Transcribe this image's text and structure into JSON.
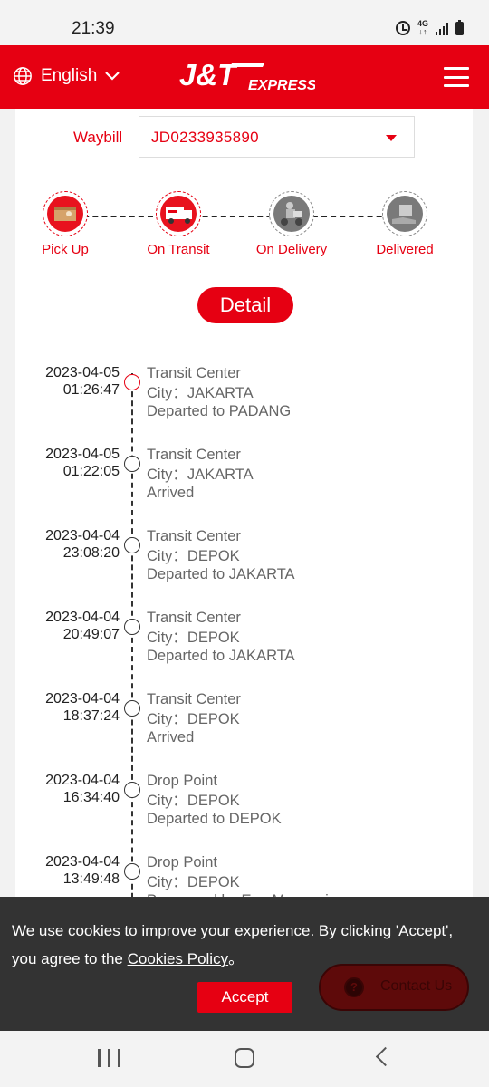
{
  "status_bar": {
    "time": "21:39",
    "network": "4G"
  },
  "header": {
    "language": "English"
  },
  "waybill": {
    "label": "Waybill",
    "value": "JD0233935890"
  },
  "steps": [
    {
      "label": "Pick Up",
      "state": "active"
    },
    {
      "label": "On Transit",
      "state": "active"
    },
    {
      "label": "On Delivery",
      "state": "inactive"
    },
    {
      "label": "Delivered",
      "state": "inactive"
    }
  ],
  "detail_button": "Detail",
  "timeline": [
    {
      "date": "2023-04-05",
      "time": "01:26:47",
      "type": "Transit Center",
      "city": "City：JAKARTA",
      "status": "Departed to PADANG"
    },
    {
      "date": "2023-04-05",
      "time": "01:22:05",
      "type": "Transit Center",
      "city": "City：JAKARTA",
      "status": "Arrived"
    },
    {
      "date": "2023-04-04",
      "time": "23:08:20",
      "type": "Transit Center",
      "city": "City：DEPOK",
      "status": "Departed to JAKARTA"
    },
    {
      "date": "2023-04-04",
      "time": "20:49:07",
      "type": "Transit Center",
      "city": "City：DEPOK",
      "status": "Departed to JAKARTA"
    },
    {
      "date": "2023-04-04",
      "time": "18:37:24",
      "type": "Transit Center",
      "city": "City：DEPOK",
      "status": "Arrived"
    },
    {
      "date": "2023-04-04",
      "time": "16:34:40",
      "type": "Drop Point",
      "city": "City：DEPOK",
      "status": "Departed to DEPOK"
    },
    {
      "date": "2023-04-04",
      "time": "13:49:48",
      "type": "Drop Point",
      "city": "City：DEPOK",
      "status": "Processed by Ega Mawarni"
    }
  ],
  "cookie": {
    "text_before": "We use cookies to improve your experience. By clicking 'Accept', you agree to the ",
    "link": "Cookies Policy",
    "text_after": "。",
    "accept": "Accept"
  },
  "contact": {
    "label": "Contact Us"
  },
  "colors": {
    "brand": "#e60012",
    "cookie_bg": "#333333"
  }
}
